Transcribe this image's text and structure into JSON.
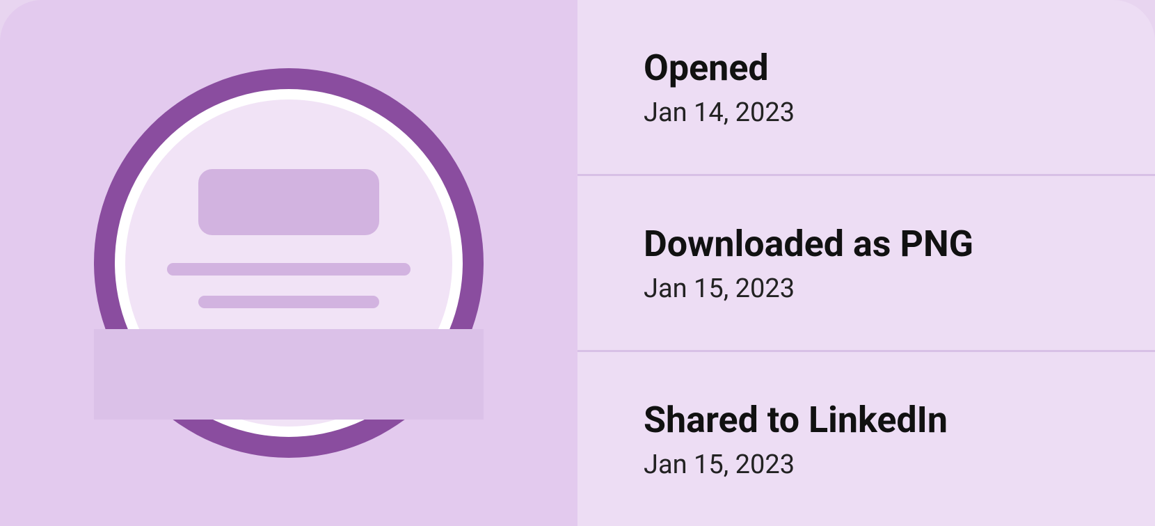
{
  "activity": [
    {
      "title": "Opened",
      "date": "Jan 14, 2023"
    },
    {
      "title": "Downloaded as PNG",
      "date": "Jan 15, 2023"
    },
    {
      "title": "Shared to LinkedIn",
      "date": "Jan 15, 2023"
    }
  ]
}
